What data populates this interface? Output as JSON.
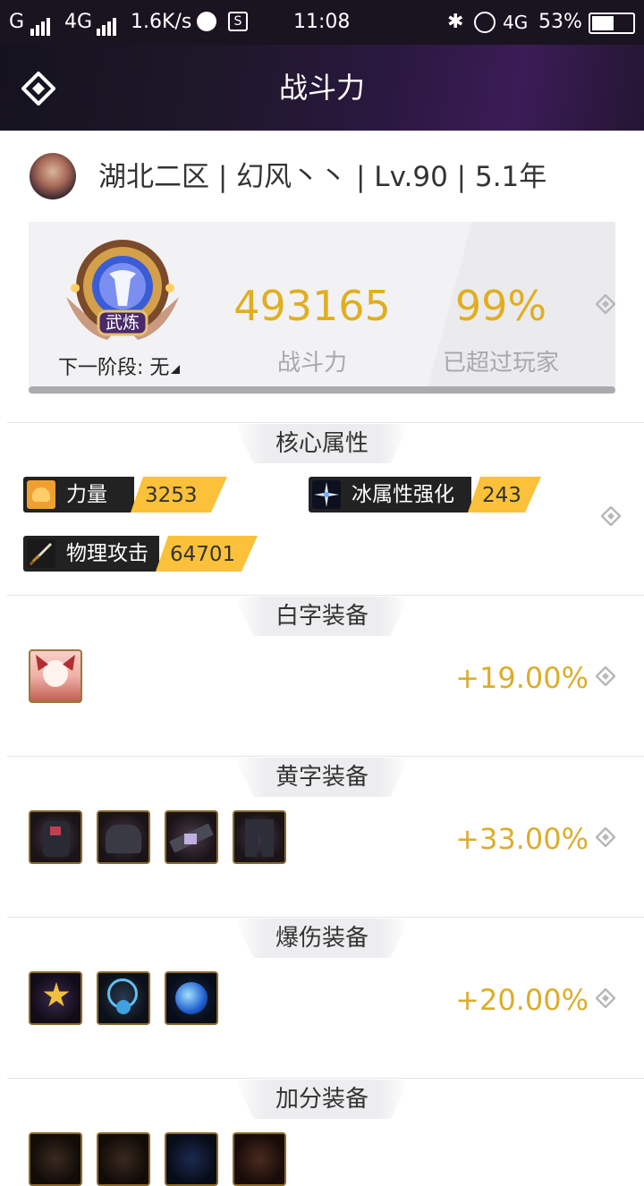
{
  "status_bar": {
    "carrier_left": "G",
    "network": "4G",
    "speed": "1.6K/s",
    "time": "11:08",
    "network_right": "4G",
    "battery": "53%"
  },
  "header": {
    "title": "战斗力"
  },
  "profile": {
    "info": "湖北二区 | 幻风丶丶 | Lv.90 | 5.1年"
  },
  "score": {
    "badge_label": "武炼",
    "next_stage": "下一阶段: 无",
    "power_value": "493165",
    "power_label": "战斗力",
    "percent_value": "99%",
    "percent_label": "已超过玩家"
  },
  "core_attributes": {
    "title": "核心属性",
    "items": [
      {
        "name": "力量",
        "value": "3253",
        "icon": "flexed-arm-icon"
      },
      {
        "name": "冰属性强化",
        "value": "243",
        "icon": "ice-sparkle-icon"
      },
      {
        "name": "物理攻击",
        "value": "64701",
        "icon": "sword-icon"
      }
    ]
  },
  "sections": [
    {
      "title": "白字装备",
      "percent": "+19.00%"
    },
    {
      "title": "黄字装备",
      "percent": "+33.00%"
    },
    {
      "title": "爆伤装备",
      "percent": "+20.00%"
    },
    {
      "title": "加分装备",
      "percent": ""
    }
  ],
  "colors": {
    "accent_gold": "#dcac2a",
    "pill_yellow": "#fbc13a",
    "header_bg": "#1d1727"
  }
}
